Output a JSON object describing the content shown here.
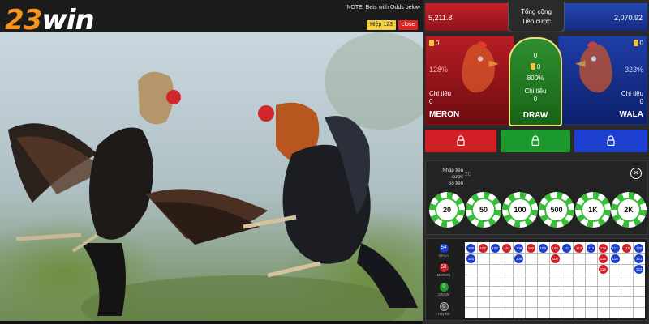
{
  "logo": {
    "number": "23",
    "word": "win"
  },
  "video": {
    "note": "NOTE: Bets with Odds below",
    "round_label": "Hiệp",
    "round_number": "123",
    "close_label": "close"
  },
  "totals": {
    "meron_total": "5,211.8",
    "wala_total": "2,070.92",
    "center_line1": "Tổng cộng",
    "center_line2": "Tiền cược"
  },
  "sides": {
    "meron": {
      "bet": "0",
      "percent": "128%",
      "spend_label": "Chi tiêu",
      "spend": "0",
      "name": "MERON"
    },
    "draw": {
      "top": "0",
      "bet": "0",
      "percent": "800%",
      "spend_label": "Chi tiêu",
      "spend": "0",
      "name": "DRAW"
    },
    "wala": {
      "bet": "0",
      "percent": "323%",
      "spend_label": "Chi tiêu",
      "spend": "0",
      "name": "WALA"
    }
  },
  "bet_input": {
    "label_line1": "Nhập tiền cược",
    "label_line2": "Số tiền",
    "value": "20"
  },
  "chips": [
    "20",
    "50",
    "100",
    "500",
    "1K",
    "2K"
  ],
  "history": {
    "legend": [
      {
        "count": "54",
        "label": "WALA",
        "color": "#1d3fd0"
      },
      {
        "count": "58",
        "label": "MERON",
        "color": "#d21f26"
      },
      {
        "count": "0",
        "label": "DRAW",
        "color": "#1d9a2e"
      },
      {
        "count": "0",
        "label": "Hủy Bỏ",
        "color": "#555555"
      }
    ],
    "beads": [
      {
        "n": "100",
        "c": "blue",
        "col": 0,
        "row": 0
      },
      {
        "n": "101",
        "c": "blue",
        "col": 0,
        "row": 1
      },
      {
        "n": "102",
        "c": "red",
        "col": 1,
        "row": 0
      },
      {
        "n": "103",
        "c": "blue",
        "col": 2,
        "row": 0
      },
      {
        "n": "104",
        "c": "red",
        "col": 3,
        "row": 0
      },
      {
        "n": "105",
        "c": "blue",
        "col": 4,
        "row": 0
      },
      {
        "n": "106",
        "c": "blue",
        "col": 4,
        "row": 1
      },
      {
        "n": "107",
        "c": "red",
        "col": 5,
        "row": 0
      },
      {
        "n": "108",
        "c": "blue",
        "col": 6,
        "row": 0
      },
      {
        "n": "109",
        "c": "red",
        "col": 7,
        "row": 0
      },
      {
        "n": "110",
        "c": "red",
        "col": 7,
        "row": 1
      },
      {
        "n": "111",
        "c": "blue",
        "col": 8,
        "row": 0
      },
      {
        "n": "112",
        "c": "red",
        "col": 9,
        "row": 0
      },
      {
        "n": "113",
        "c": "blue",
        "col": 10,
        "row": 0
      },
      {
        "n": "114",
        "c": "red",
        "col": 11,
        "row": 0
      },
      {
        "n": "115",
        "c": "red",
        "col": 11,
        "row": 1
      },
      {
        "n": "116",
        "c": "red",
        "col": 11,
        "row": 2
      },
      {
        "n": "117",
        "c": "blue",
        "col": 12,
        "row": 0
      },
      {
        "n": "118",
        "c": "blue",
        "col": 12,
        "row": 1
      },
      {
        "n": "119",
        "c": "red",
        "col": 13,
        "row": 0
      },
      {
        "n": "120",
        "c": "blue",
        "col": 14,
        "row": 0
      },
      {
        "n": "121",
        "c": "blue",
        "col": 14,
        "row": 1
      },
      {
        "n": "122",
        "c": "blue",
        "col": 14,
        "row": 2
      }
    ]
  },
  "colors": {
    "meron": "#d21f26",
    "draw": "#1d9a2e",
    "wala": "#1d3fd0",
    "logo_accent": "#f7941d"
  }
}
